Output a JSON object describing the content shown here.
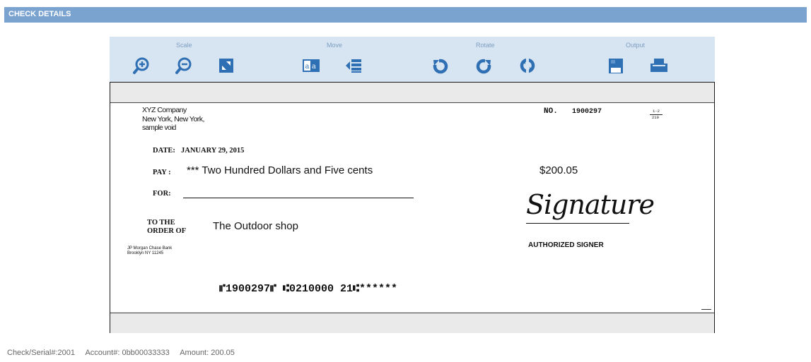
{
  "header": {
    "title": "CHECK DETAILS"
  },
  "toolbar": {
    "groups": [
      {
        "label": "Scale"
      },
      {
        "label": "Move"
      },
      {
        "label": "Rotate"
      },
      {
        "label": "Output"
      }
    ],
    "icons": [
      "zoom-in-icon",
      "zoom-out-icon",
      "fit-to-window-icon",
      "toggle-text-icon",
      "move-left-icon",
      "rotate-left-icon",
      "rotate-right-icon",
      "flip-icon",
      "save-icon",
      "print-icon"
    ],
    "accent": "#2f6fb3",
    "background": "#d7e4f1"
  },
  "check": {
    "payer_name": "XYZ Company",
    "payer_city": "New York, New York,",
    "sample_note": "sample void",
    "number_label": "NO.",
    "number": "1900297",
    "routing_fraction_top": "1-2",
    "routing_fraction_bottom": "210",
    "date_label": "DATE:",
    "date_value": "JANUARY 29, 2015",
    "pay_label": "PAY :",
    "pay_words": "*** Two Hundred Dollars and Five cents",
    "amount": "$200.05",
    "for_label": "FOR:",
    "to_the": "TO THE",
    "order_of": "ORDER OF",
    "payee": "The Outdoor shop",
    "bank_name": "JP Morgan Chase Bank",
    "bank_city": "Brooklyn NY 11245",
    "signature": "Signature",
    "signer_label": "AUTHORIZED SIGNER",
    "micr_line": "⑈1900297⑈ ⑆0210000 21⑆******"
  },
  "footer": {
    "serial": "Check/Serial#:2001",
    "account": "Account#: 0bb00033333",
    "amount": "Amount: 200.05"
  }
}
